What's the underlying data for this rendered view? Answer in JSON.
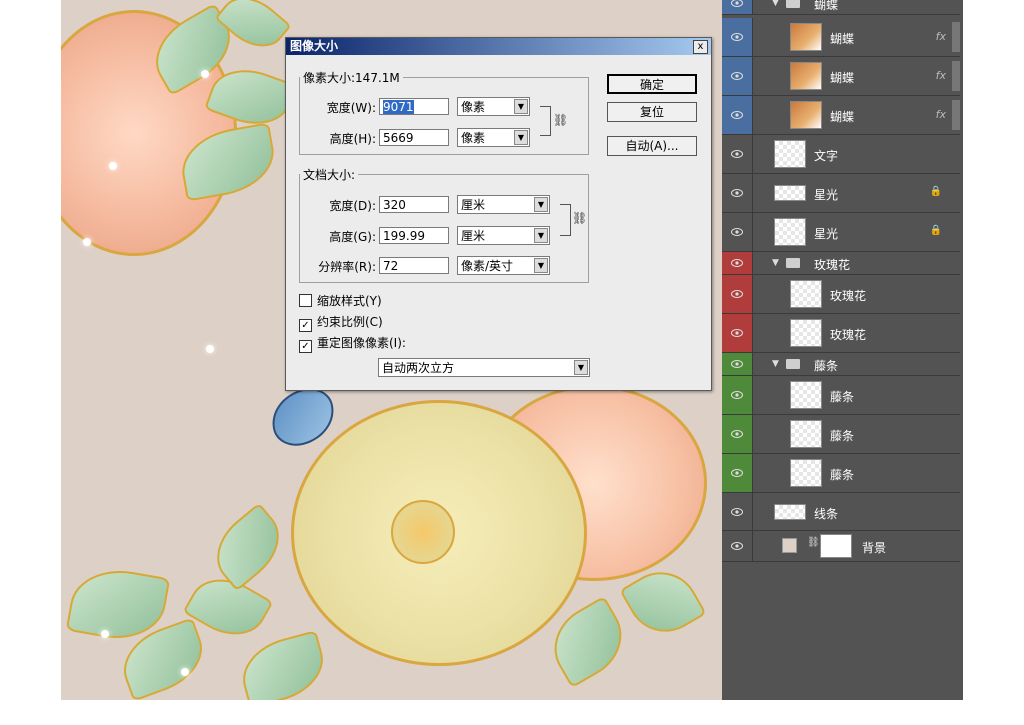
{
  "dialog": {
    "title": "图像大小",
    "close": "x",
    "pixel_dimensions_legend": "像素大小:147.1M",
    "pixel_width_label": "宽度(W):",
    "pixel_width_value": "9071",
    "pixel_width_unit": "像素",
    "pixel_height_label": "高度(H):",
    "pixel_height_value": "5669",
    "pixel_height_unit": "像素",
    "doc_size_legend": "文档大小:",
    "doc_width_label": "宽度(D):",
    "doc_width_value": "320",
    "doc_width_unit": "厘米",
    "doc_height_label": "高度(G):",
    "doc_height_value": "199.99",
    "doc_height_unit": "厘米",
    "resolution_label": "分辨率(R):",
    "resolution_value": "72",
    "resolution_unit": "像素/英寸",
    "scale_styles_label": "缩放样式(Y)",
    "scale_styles_checked": false,
    "constrain_label": "约束比例(C)",
    "constrain_checked": true,
    "resample_label": "重定图像像素(I):",
    "resample_checked": true,
    "resample_method": "自动两次立方",
    "ok_label": "确定",
    "reset_label": "复位",
    "auto_label": "自动(A)..."
  },
  "layers": [
    {
      "name": "蝴蝶",
      "type": "group",
      "color": "blue"
    },
    {
      "name": "蝴蝶",
      "type": "layer",
      "color": "blue",
      "fx": "fx"
    },
    {
      "name": "蝴蝶",
      "type": "layer",
      "color": "blue",
      "fx": "fx"
    },
    {
      "name": "蝴蝶",
      "type": "layer",
      "color": "blue",
      "fx": "fx"
    },
    {
      "name": "文字",
      "type": "layer",
      "color": "none"
    },
    {
      "name": "星光",
      "type": "layer",
      "color": "none",
      "locked": true
    },
    {
      "name": "星光",
      "type": "layer",
      "color": "none",
      "locked": true
    },
    {
      "name": "玫瑰花",
      "type": "group",
      "color": "red"
    },
    {
      "name": "玫瑰花",
      "type": "layer",
      "color": "red"
    },
    {
      "name": "玫瑰花",
      "type": "layer",
      "color": "red"
    },
    {
      "name": "藤条",
      "type": "group",
      "color": "green"
    },
    {
      "name": "藤条",
      "type": "layer",
      "color": "green"
    },
    {
      "name": "藤条",
      "type": "layer",
      "color": "green"
    },
    {
      "name": "藤条",
      "type": "layer",
      "color": "green"
    },
    {
      "name": "线条",
      "type": "layer",
      "color": "none"
    },
    {
      "name": "背景",
      "type": "layer",
      "color": "none"
    }
  ],
  "colors": {
    "canvas_bg": "#ddd0c6",
    "panel_bg": "#535353",
    "label_blue": "#4a6ea0",
    "label_red": "#b03c3c",
    "label_green": "#4f8a3a"
  }
}
